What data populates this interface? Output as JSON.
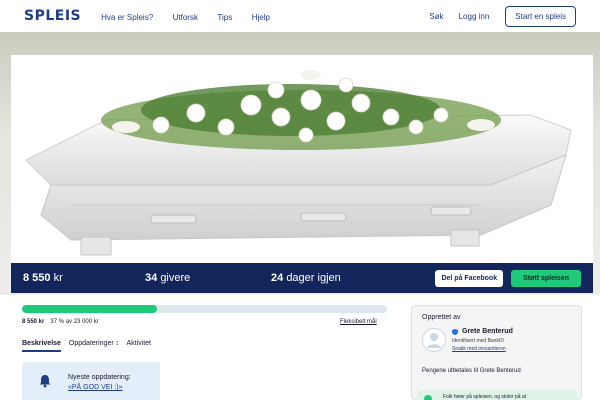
{
  "header": {
    "logo": "SPLEIS",
    "nav": [
      "Hva er Spleis?",
      "Utforsk",
      "Tips",
      "Hjelp"
    ],
    "search": "Søk",
    "login": "Logg inn",
    "start_button": "Start en spleis"
  },
  "stats": {
    "amount": "8 550",
    "currency": "kr",
    "givers_count": "34",
    "givers_label": "givere",
    "days_count": "24",
    "days_label": "dager igjen",
    "facebook_button": "Del på Facebook",
    "support_button": "Støtt spleisen"
  },
  "progress": {
    "fraction": 0.37,
    "amount": "8 550 kr",
    "detail": "37 % av 23 000 kr",
    "flex_goal": "Fleksibelt mål"
  },
  "tabs": [
    {
      "label": "Beskrivelse"
    },
    {
      "label": "Oppdateringer",
      "count": "1"
    },
    {
      "label": "Aktivitet"
    }
  ],
  "update": {
    "title": "Nyeste oppdatering:",
    "link": "«PÅ GOD VEI :)»"
  },
  "sidebar": {
    "created_by": "Opprettet av",
    "creator": "Grete Benterud",
    "id_text": "Identifisert med BankID",
    "contact": "Snakk med innsamleren",
    "payout": "Pengene utbetales til Grete Benterud",
    "trust": "Folk heier på spleisen, og stoler på at"
  },
  "colors": {
    "brand_navy": "#13265c",
    "accent_green": "#1fc97a"
  }
}
